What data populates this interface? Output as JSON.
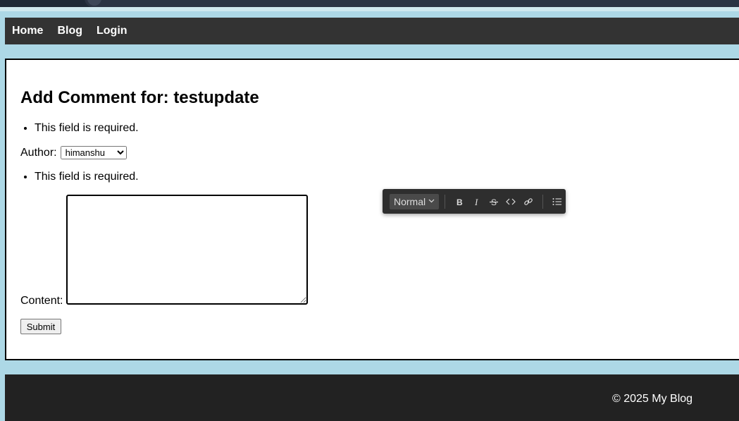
{
  "nav": {
    "items": [
      "Home",
      "Blog",
      "Login"
    ]
  },
  "form": {
    "title": "Add Comment for: testupdate",
    "author_error": "This field is required.",
    "author_label": "Author:",
    "author_value": "himanshu",
    "content_error": "This field is required.",
    "content_label": "Content:",
    "content_value": "",
    "submit_label": "Submit"
  },
  "toolbar": {
    "format_label": "Normal",
    "buttons": [
      "bold-icon",
      "italic-icon",
      "strikethrough-icon",
      "code-icon",
      "link-icon",
      "bullet-list-icon"
    ]
  },
  "footer": {
    "copyright": "© 2025 My Blog"
  },
  "colors": {
    "page_bg": "#add8e6",
    "nav_bg": "#333333",
    "footer_bg": "#222222",
    "toolbar_bg": "#2e2e2e"
  }
}
